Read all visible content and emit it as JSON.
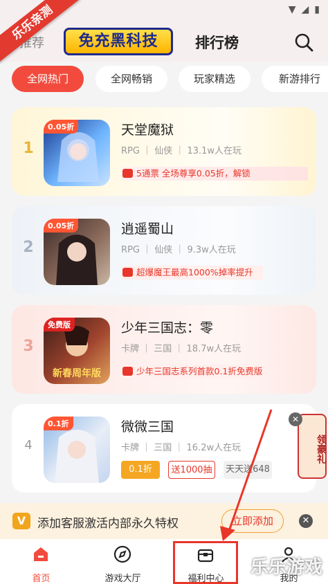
{
  "corner_ribbon": "乐乐亲测",
  "header": {
    "tab_recommend": "推荐",
    "logo_text": "免充黑科技",
    "tab_ranking": "排行榜"
  },
  "filters": [
    "全网热门",
    "全网畅销",
    "玩家精选",
    "新游排行"
  ],
  "games": [
    {
      "rank": "1",
      "title": "天堂魔狱",
      "meta": "RPG ｜ 仙侠 ｜ 13.1w人在玩",
      "promo": "5通票            全场尊享0.05折，解锁",
      "discount": "0.05折"
    },
    {
      "rank": "2",
      "title": "逍遥蜀山",
      "meta": "RPG ｜ 仙侠 ｜ 9.3w人在玩",
      "promo": "超爆魔王最高1000%掉率提升",
      "discount": "0.05折"
    },
    {
      "rank": "3",
      "title": "少年三国志：零",
      "meta": "卡牌 ｜ 三国 ｜ 18.7w人在玩",
      "promo": "少年三国志系列首款0.1折免费版",
      "discount": "免费版",
      "thumb_text": "新春周年版"
    },
    {
      "rank": "4",
      "title": "微微三国",
      "meta": "卡牌 ｜ 三国 ｜ 16.2w人在玩",
      "discount": "0.1折",
      "tags": [
        "0.1折",
        "送1000抽",
        "天天送648"
      ]
    }
  ],
  "gift": {
    "text": "领豪礼"
  },
  "banner": {
    "vip": "V",
    "text": "添加客服激活内部永久特权",
    "button": "立即添加"
  },
  "nav": [
    "首页",
    "游戏大厅",
    "福利中心",
    "我的"
  ],
  "watermark": "乐乐游戏",
  "colors": {
    "accent": "#f24b3d",
    "gold": "#e8a433"
  }
}
